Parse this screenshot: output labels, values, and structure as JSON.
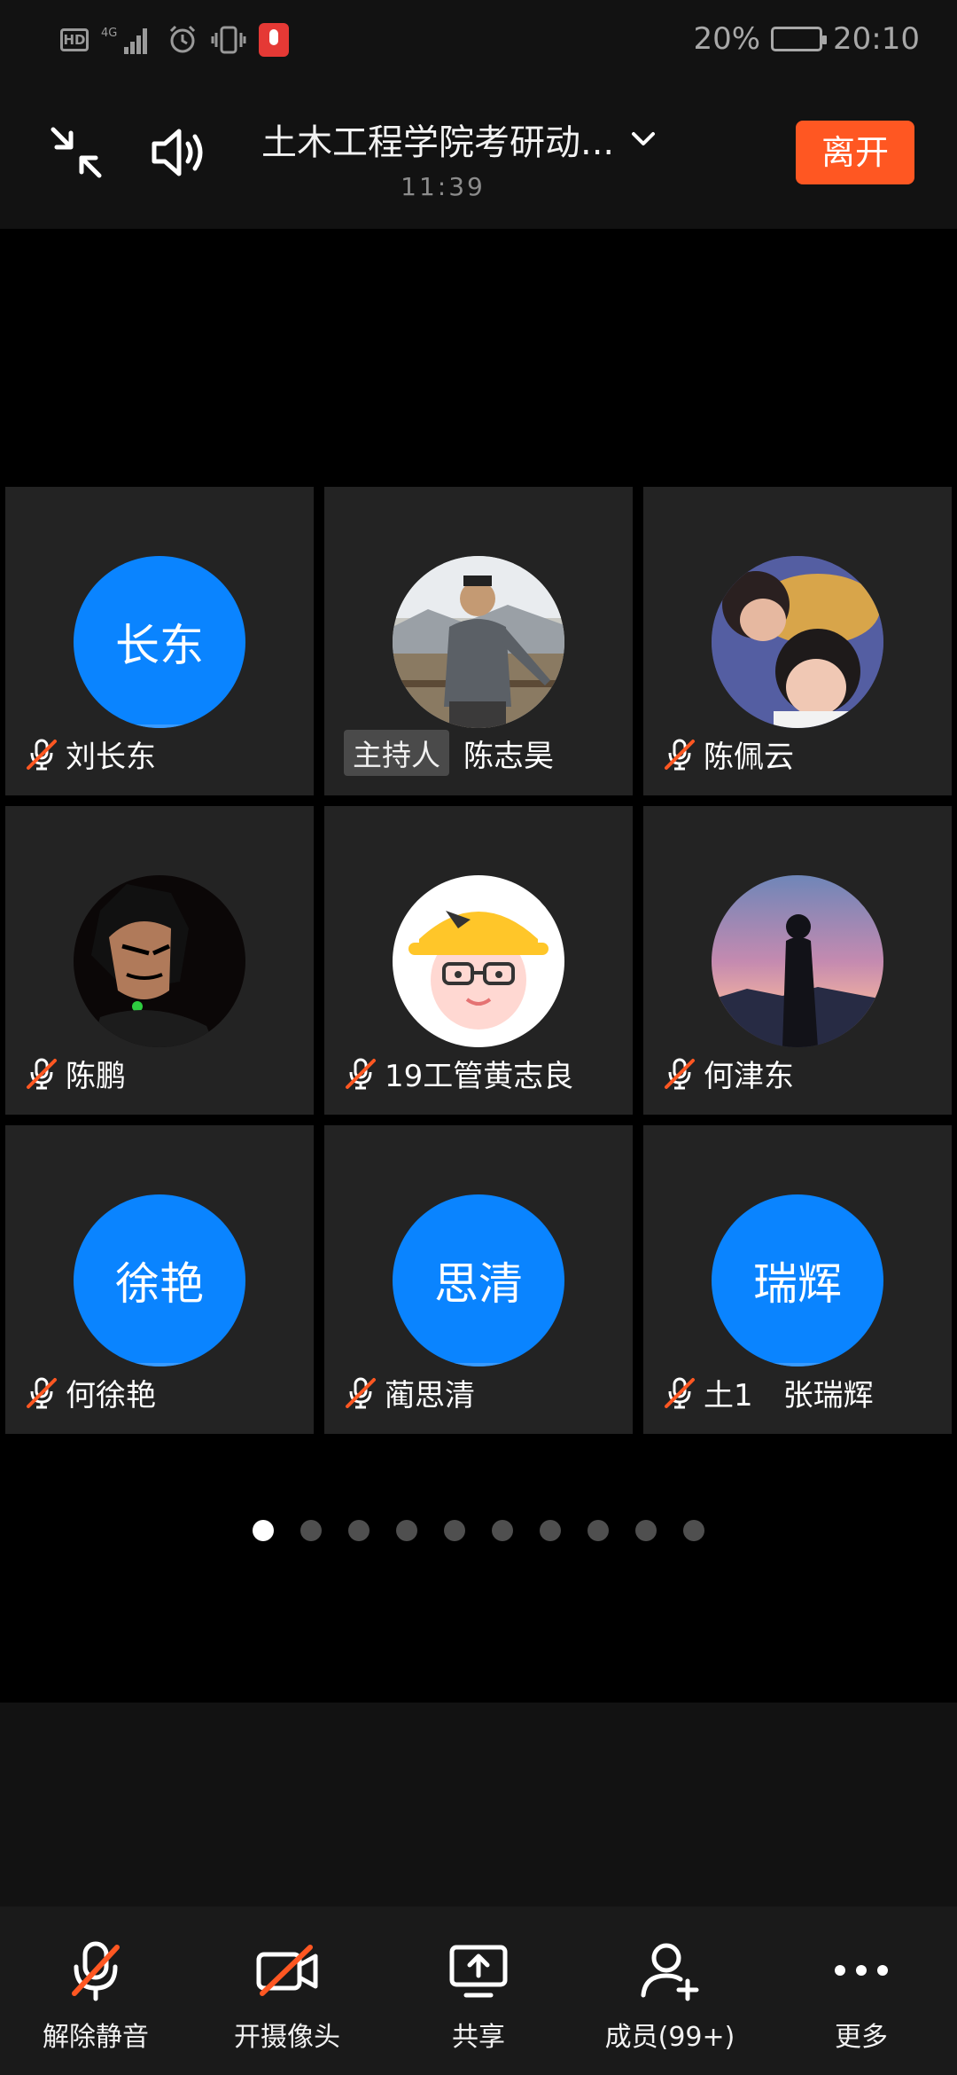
{
  "status_bar": {
    "hd_label": "HD",
    "network": "4G",
    "battery_percent": "20%",
    "time": "20:10"
  },
  "header": {
    "title": "土木工程学院考研动...",
    "elapsed_time": "11:39",
    "leave_label": "离开"
  },
  "participants": [
    {
      "name": "刘长东",
      "avatar_text": "长东",
      "avatar_type": "text",
      "muted": true
    },
    {
      "name": "陈志昊",
      "badge": "主持人",
      "avatar_type": "photo",
      "muted": false
    },
    {
      "name": "陈佩云",
      "avatar_type": "photo",
      "muted": true
    },
    {
      "name": "陈鹏",
      "avatar_type": "photo",
      "muted": true
    },
    {
      "name": "19工管黄志良",
      "avatar_type": "cartoon",
      "muted": true
    },
    {
      "name": "何津东",
      "avatar_type": "photo",
      "muted": true
    },
    {
      "name": "何徐艳",
      "avatar_text": "徐艳",
      "avatar_type": "text",
      "muted": true
    },
    {
      "name": "蔺思清",
      "avatar_text": "思清",
      "avatar_type": "text",
      "muted": true
    },
    {
      "name": "土1　张瑞辉",
      "avatar_text": "瑞辉",
      "avatar_type": "text",
      "muted": true
    }
  ],
  "pagination": {
    "total": 10,
    "current": 1
  },
  "toolbar": {
    "unmute_label": "解除静音",
    "camera_label": "开摄像头",
    "share_label": "共享",
    "members_label": "成员(99+)",
    "more_label": "更多"
  },
  "colors": {
    "accent": "#0a84ff",
    "leave": "#ff5722",
    "muted_slash": "#ff5722"
  }
}
